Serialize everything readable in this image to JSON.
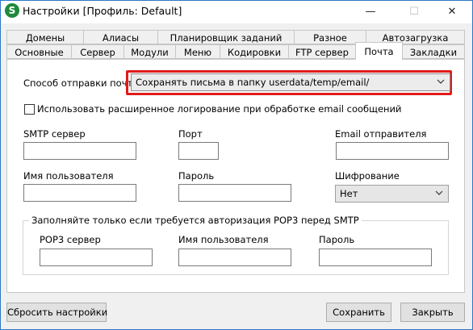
{
  "window": {
    "title": "Настройки [Профиль: Default]",
    "logo_letter": "S",
    "controls": {
      "minimize": "—",
      "maximize": "☐",
      "close": "✕"
    }
  },
  "tabs": {
    "row_back": [
      "Домены",
      "Алиасы",
      "Планировщик заданий",
      "Разное",
      "Автозагрузка"
    ],
    "row_front": [
      "Основные",
      "Сервер",
      "Модули",
      "Меню",
      "Кодировки",
      "FTP сервер",
      "Почта",
      "Закладки"
    ],
    "active": "Почта"
  },
  "mail": {
    "send_mode_label": "Способ отправки почты:",
    "send_mode_value": "Сохранять письма в папку userdata/temp/email/",
    "extended_logging_label": "Использовать расширенное логирование при обработке email сообщений",
    "extended_logging_checked": false,
    "smtp_server_label": "SMTP сервер",
    "smtp_server_value": "",
    "port_label": "Порт",
    "port_value": "",
    "sender_email_label": "Email отправителя",
    "sender_email_value": "",
    "username_label": "Имя пользователя",
    "username_value": "",
    "password_label": "Пароль",
    "password_value": "",
    "encryption_label": "Шифрование",
    "encryption_value": "Нет",
    "pop3_group": {
      "title": "Заполняйте только если требуется авторизация POP3 перед SMTP",
      "server_label": "POP3 сервер",
      "server_value": "",
      "username_label": "Имя пользователя",
      "username_value": "",
      "password_label": "Пароль",
      "password_value": ""
    }
  },
  "footer": {
    "reset_label": "Сбросить настройки",
    "save_label": "Сохранить",
    "close_label": "Закрыть"
  },
  "colors": {
    "highlight": "#e11b1b",
    "logo": "#1e8b3c",
    "window_border": "#2b78c7"
  }
}
